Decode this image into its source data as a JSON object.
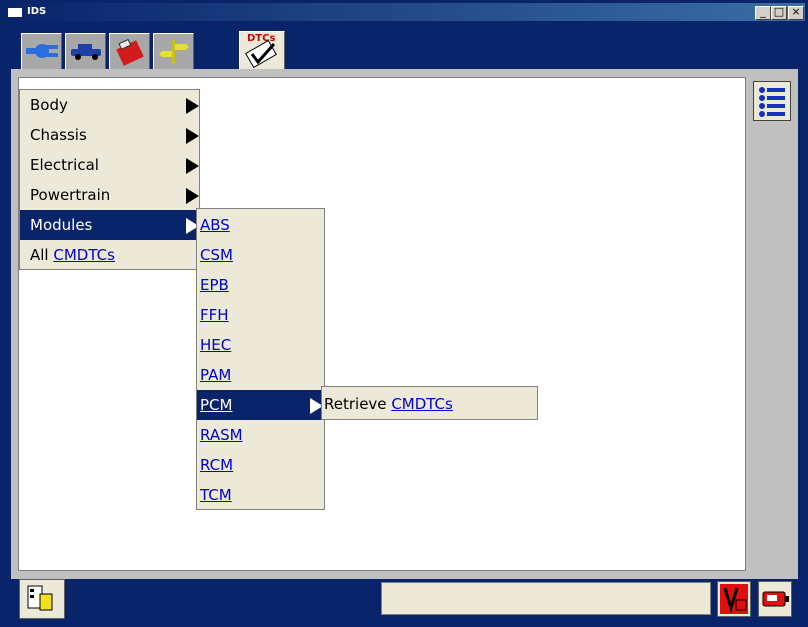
{
  "window": {
    "title": "IDS",
    "minimize": "_",
    "maximize": "□",
    "close": "×"
  },
  "toolbar": {
    "tabs": [
      {
        "icon": "connector-icon"
      },
      {
        "icon": "vehicle-icon"
      },
      {
        "icon": "toolbox-icon"
      },
      {
        "icon": "signpost-icon"
      }
    ],
    "dtc_tab": {
      "label": "DTCs",
      "icon": "dtc-check-icon"
    }
  },
  "main_menu": {
    "items": [
      {
        "label": "Body",
        "has_submenu": true
      },
      {
        "label": "Chassis",
        "has_submenu": true
      },
      {
        "label": "Electrical",
        "has_submenu": true
      },
      {
        "label": "Powertrain",
        "has_submenu": true
      },
      {
        "label": "Modules",
        "has_submenu": true,
        "selected": true
      },
      {
        "label_prefix": "All",
        "label_link": "CMDTCs",
        "has_submenu": false
      }
    ]
  },
  "modules_menu": {
    "items": [
      "ABS",
      "CSM",
      "EPB",
      "FFH",
      "HEC",
      "PAM",
      "PCM",
      "RASM",
      "RCM",
      "TCM"
    ],
    "selected": "PCM"
  },
  "pcm_menu": {
    "prefix": "Retrieve",
    "link": "CMDTCs"
  },
  "side": {
    "list_icon": "list-icon"
  },
  "statusbar": {
    "text": "",
    "left_icon": "toolbox-search-icon",
    "right_icons": [
      "voltage-icon",
      "vci-device-icon"
    ]
  },
  "colors": {
    "titlebar": "#0a246a",
    "menu_bg": "#ece9d8",
    "highlight": "#0a246a",
    "link": "#0000cc"
  }
}
